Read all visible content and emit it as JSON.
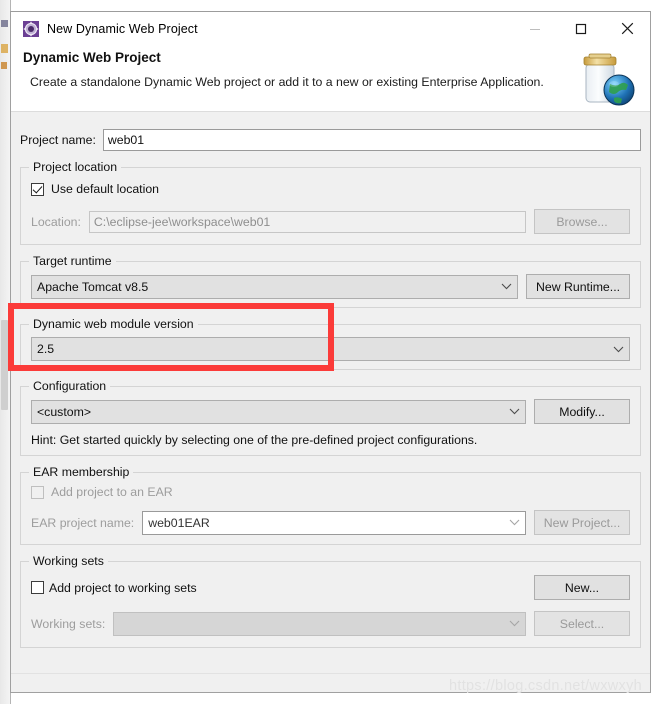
{
  "window": {
    "title": "New Dynamic Web Project",
    "icon": "eclipse-wizard-icon",
    "minimize_label": "minimize-icon",
    "maximize_label": "maximize-icon",
    "close_label": "close-icon"
  },
  "header": {
    "title": "Dynamic Web Project",
    "description": "Create a standalone Dynamic Web project or add it to a new or existing Enterprise Application.",
    "art": "jar-with-globe-icon"
  },
  "form": {
    "project_name_label": "Project name:",
    "project_name_value": "web01",
    "project_name_placeholder": "",
    "project_location": {
      "group_title": "Project location",
      "use_default_label": "Use default location",
      "use_default_checked": true,
      "location_label": "Location:",
      "location_value": "C:\\eclipse-jee\\workspace\\web01",
      "browse_label": "Browse..."
    },
    "target_runtime": {
      "group_title": "Target runtime",
      "value": "Apache Tomcat v8.5",
      "new_runtime_label": "New Runtime..."
    },
    "dynamic_web_module": {
      "group_title": "Dynamic web module version",
      "value": "2.5"
    },
    "configuration": {
      "group_title": "Configuration",
      "value": "<custom>",
      "modify_label": "Modify...",
      "hint": "Hint: Get started quickly by selecting one of the pre-defined project configurations."
    },
    "ear_membership": {
      "group_title": "EAR membership",
      "add_to_ear_label": "Add project to an EAR",
      "add_to_ear_checked": false,
      "ear_project_name_label": "EAR project name:",
      "ear_project_name_value": "web01EAR",
      "new_project_label": "New Project..."
    },
    "working_sets": {
      "group_title": "Working sets",
      "add_to_working_sets_label": "Add project to working sets",
      "add_to_working_sets_checked": false,
      "new_label": "New...",
      "working_sets_label": "Working sets:",
      "working_sets_value": "",
      "select_label": "Select..."
    }
  },
  "annotation": {
    "color": "#fb3b39"
  },
  "watermark": {
    "text": "https://blog.csdn.net/wxwxyh"
  }
}
